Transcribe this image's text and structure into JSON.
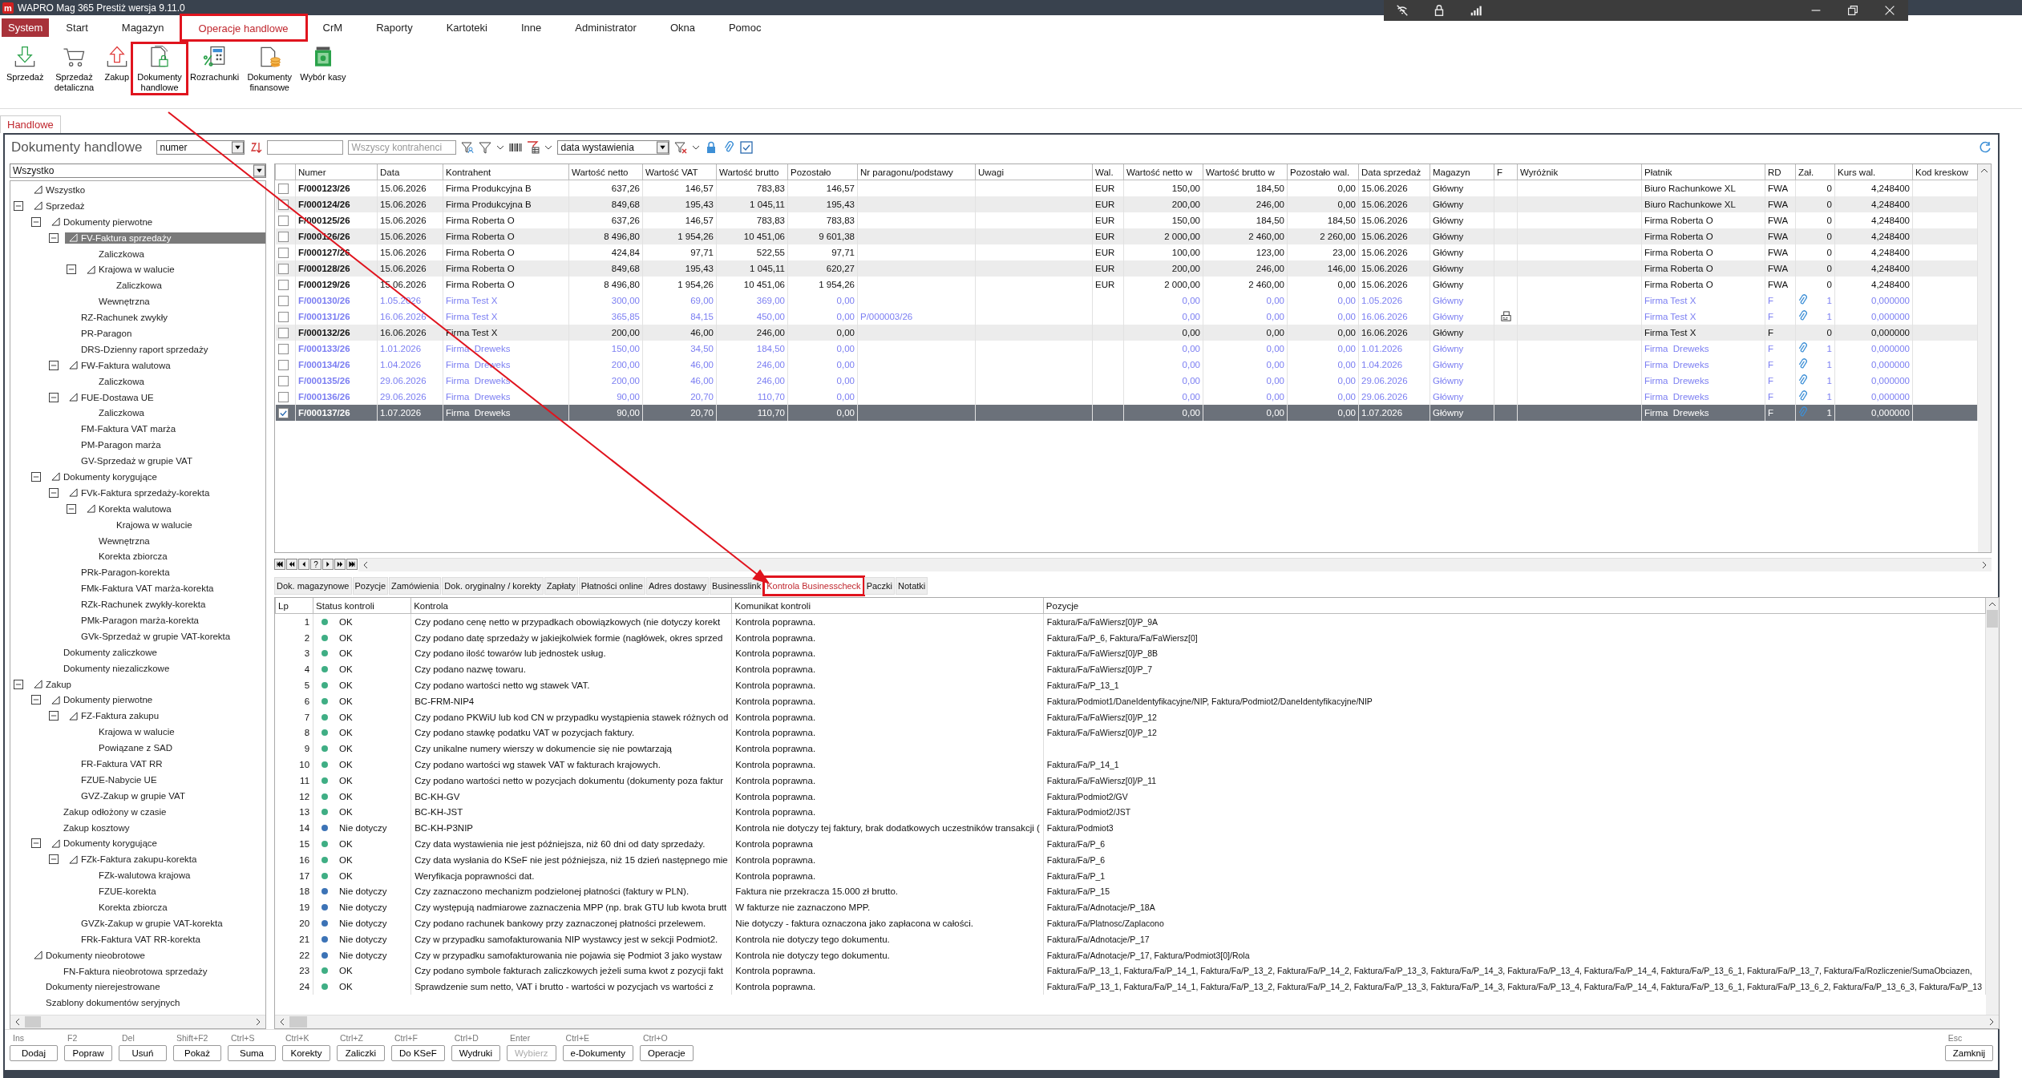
{
  "window": {
    "logo_letter": "m",
    "title": "WAPRO Mag 365 Prestiż  wersja 9.11.0"
  },
  "menu": [
    {
      "label": "System",
      "kind": "app",
      "selected": false,
      "highlighted": false
    },
    {
      "label": "Start",
      "kind": "menu",
      "selected": false,
      "highlighted": false
    },
    {
      "label": "Magazyn",
      "kind": "menu",
      "selected": false,
      "highlighted": false
    },
    {
      "label": "Operacje handlowe",
      "kind": "menu",
      "selected": true,
      "highlighted": true
    },
    {
      "label": "CrM",
      "kind": "menu",
      "selected": false,
      "highlighted": false
    },
    {
      "label": "Raporty",
      "kind": "menu",
      "selected": false,
      "highlighted": false
    },
    {
      "label": "Kartoteki",
      "kind": "menu",
      "selected": false,
      "highlighted": false
    },
    {
      "label": "Inne",
      "kind": "menu",
      "selected": false,
      "highlighted": false
    },
    {
      "label": "Administrator",
      "kind": "menu",
      "selected": false,
      "highlighted": false
    },
    {
      "label": "Okna",
      "kind": "menu",
      "selected": false,
      "highlighted": false
    },
    {
      "label": "Pomoc",
      "kind": "menu",
      "selected": false,
      "highlighted": false
    }
  ],
  "ribbon": [
    {
      "label": "Sprzedaż",
      "highlighted": false
    },
    {
      "label": "Sprzedaż detaliczna",
      "highlighted": false
    },
    {
      "label": "Zakup",
      "highlighted": false
    },
    {
      "label": "Dokumenty handlowe",
      "highlighted": true
    },
    {
      "label": "Rozrachunki",
      "highlighted": false
    },
    {
      "label": "Dokumenty finansowe",
      "highlighted": false
    },
    {
      "label": "Wybór kasy",
      "highlighted": false
    }
  ],
  "page_tabs": [
    {
      "label": "Handlowe",
      "selected": true
    }
  ],
  "filter_bar": {
    "title": "Dokumenty handlowe",
    "sort_field": "numer",
    "contractor_placeholder": "Wszyscy kontrahenci",
    "date_field": "data wystawienia"
  },
  "tree": {
    "filter": "Wszystko",
    "items": [
      {
        "label": "Wszystko",
        "kind": "folder",
        "selected": false
      },
      {
        "label": "Sprzedaż",
        "kind": "folder",
        "selected": false,
        "expanded": true,
        "children": [
          {
            "label": "Dokumenty pierwotne",
            "kind": "folder",
            "selected": false,
            "expanded": true,
            "children": [
              {
                "label": "FV-Faktura sprzedaży",
                "kind": "folder",
                "selected": true,
                "expanded": true,
                "children": [
                  {
                    "label": "Zaliczkowa",
                    "kind": "leaf",
                    "selected": false
                  },
                  {
                    "label": "Krajowa w walucie",
                    "kind": "folder",
                    "selected": false,
                    "expanded": true,
                    "children": [
                      {
                        "label": "Zaliczkowa",
                        "kind": "leaf",
                        "selected": false
                      }
                    ]
                  },
                  {
                    "label": "Wewnętrzna",
                    "kind": "leaf",
                    "selected": false
                  }
                ]
              },
              {
                "label": "RZ-Rachunek zwykły",
                "kind": "leaf",
                "selected": false
              },
              {
                "label": "PR-Paragon",
                "kind": "leaf",
                "selected": false
              },
              {
                "label": "DRS-Dzienny raport sprzedaży",
                "kind": "leaf",
                "selected": false
              },
              {
                "label": "FW-Faktura walutowa",
                "kind": "folder",
                "selected": false,
                "expanded": true,
                "children": [
                  {
                    "label": "Zaliczkowa",
                    "kind": "leaf",
                    "selected": false
                  }
                ]
              },
              {
                "label": "FUE-Dostawa UE",
                "kind": "folder",
                "selected": false,
                "expanded": true,
                "children": [
                  {
                    "label": "Zaliczkowa",
                    "kind": "leaf",
                    "selected": false
                  }
                ]
              },
              {
                "label": "FM-Faktura VAT marża",
                "kind": "leaf",
                "selected": false
              },
              {
                "label": "PM-Paragon marża",
                "kind": "leaf",
                "selected": false
              },
              {
                "label": "GV-Sprzedaż w grupie VAT",
                "kind": "leaf",
                "selected": false
              }
            ]
          },
          {
            "label": "Dokumenty korygujące",
            "kind": "folder",
            "selected": false,
            "expanded": true,
            "children": [
              {
                "label": "FVk-Faktura sprzedaży-korekta",
                "kind": "folder",
                "selected": false,
                "expanded": true,
                "children": [
                  {
                    "label": "Korekta walutowa",
                    "kind": "folder",
                    "selected": false,
                    "expanded": true,
                    "children": [
                      {
                        "label": "Krajowa w walucie",
                        "kind": "leaf",
                        "selected": false
                      }
                    ]
                  },
                  {
                    "label": "Wewnętrzna",
                    "kind": "leaf",
                    "selected": false
                  },
                  {
                    "label": "Korekta zbiorcza",
                    "kind": "leaf",
                    "selected": false
                  }
                ]
              },
              {
                "label": "PRk-Paragon-korekta",
                "kind": "leaf",
                "selected": false
              },
              {
                "label": "FMk-Faktura VAT marża-korekta",
                "kind": "leaf",
                "selected": false
              },
              {
                "label": "RZk-Rachunek zwykły-korekta",
                "kind": "leaf",
                "selected": false
              },
              {
                "label": "PMk-Paragon marża-korekta",
                "kind": "leaf",
                "selected": false
              },
              {
                "label": "GVk-Sprzedaż w grupie VAT-korekta",
                "kind": "leaf",
                "selected": false
              }
            ]
          },
          {
            "label": "Dokumenty zaliczkowe",
            "kind": "leaf",
            "selected": false
          },
          {
            "label": "Dokumenty niezaliczkowe",
            "kind": "leaf",
            "selected": false
          }
        ]
      },
      {
        "label": "Zakup",
        "kind": "folder",
        "selected": false,
        "expanded": true,
        "children": [
          {
            "label": "Dokumenty pierwotne",
            "kind": "folder",
            "selected": false,
            "expanded": true,
            "children": [
              {
                "label": "FZ-Faktura zakupu",
                "kind": "folder",
                "selected": false,
                "expanded": true,
                "children": [
                  {
                    "label": "Krajowa w walucie",
                    "kind": "leaf",
                    "selected": false
                  },
                  {
                    "label": "Powiązane z SAD",
                    "kind": "leaf",
                    "selected": false
                  }
                ]
              },
              {
                "label": "FR-Faktura VAT RR",
                "kind": "leaf",
                "selected": false
              },
              {
                "label": "FZUE-Nabycie UE",
                "kind": "leaf",
                "selected": false
              },
              {
                "label": "GVZ-Zakup w grupie VAT",
                "kind": "leaf",
                "selected": false
              }
            ]
          },
          {
            "label": "Zakup odłożony w czasie",
            "kind": "leaf",
            "selected": false
          },
          {
            "label": "Zakup kosztowy",
            "kind": "leaf",
            "selected": false
          },
          {
            "label": "Dokumenty korygujące",
            "kind": "folder",
            "selected": false,
            "expanded": true,
            "children": [
              {
                "label": "FZk-Faktura zakupu-korekta",
                "kind": "folder",
                "selected": false,
                "expanded": true,
                "children": [
                  {
                    "label": "FZk-walutowa krajowa",
                    "kind": "leaf",
                    "selected": false
                  },
                  {
                    "label": "FZUE-korekta",
                    "kind": "leaf",
                    "selected": false
                  },
                  {
                    "label": "Korekta zbiorcza",
                    "kind": "leaf",
                    "selected": false
                  }
                ]
              },
              {
                "label": "GVZk-Zakup w grupie VAT-korekta",
                "kind": "leaf",
                "selected": false
              },
              {
                "label": "FRk-Faktura VAT RR-korekta",
                "kind": "leaf",
                "selected": false
              }
            ]
          }
        ]
      },
      {
        "label": "Dokumenty nieobrotowe",
        "kind": "folder",
        "selected": false,
        "children": [
          {
            "label": "FN-Faktura nieobrotowa sprzedaży",
            "kind": "leaf",
            "selected": false
          }
        ]
      },
      {
        "label": "Dokumenty nierejestrowane",
        "kind": "leaf",
        "selected": false
      },
      {
        "label": "Szablony dokumentów seryjnych",
        "kind": "leaf",
        "selected": false
      }
    ]
  },
  "documents": {
    "columns": [
      {
        "label": "Numer",
        "kind": "text"
      },
      {
        "label": "Data",
        "kind": "text"
      },
      {
        "label": "Kontrahent",
        "kind": "text"
      },
      {
        "label": "Wartość netto",
        "kind": "num"
      },
      {
        "label": "Wartość VAT",
        "kind": "num"
      },
      {
        "label": "Wartość brutto",
        "kind": "num"
      },
      {
        "label": "Pozostało",
        "kind": "num"
      },
      {
        "label": "Nr paragonu/podstawy",
        "kind": "text"
      },
      {
        "label": "Uwagi",
        "kind": "text"
      },
      {
        "label": "Wal.",
        "kind": "text"
      },
      {
        "label": "Wartość netto w",
        "kind": "num"
      },
      {
        "label": "Wartość brutto w",
        "kind": "num"
      },
      {
        "label": "Pozostało wal.",
        "kind": "num"
      },
      {
        "label": "Data sprzedaż",
        "kind": "text"
      },
      {
        "label": "Magazyn",
        "kind": "text"
      },
      {
        "label": "F",
        "kind": "flag"
      },
      {
        "label": "Wyróżnik",
        "kind": "text"
      },
      {
        "label": "Płatnik",
        "kind": "text"
      },
      {
        "label": "RD",
        "kind": "text"
      },
      {
        "label": "Zał.",
        "kind": "attach"
      },
      {
        "label": "Kurs wal.",
        "kind": "num"
      },
      {
        "label": "Kod kreskow",
        "kind": "text"
      }
    ],
    "rows": [
      {
        "selected": false,
        "checked": false,
        "dimmed": false,
        "fiscal": false,
        "attachment": false,
        "cells": [
          "F/000123/26",
          "15.06.2026",
          "Firma Produkcyjna B",
          "637,26",
          "146,57",
          "783,83",
          "146,57",
          null,
          null,
          "EUR",
          "150,00",
          "184,50",
          "0,00",
          "15.06.2026",
          "Główny",
          null,
          null,
          "Biuro Rachunkowe XL",
          "FWA",
          "0",
          "4,248400",
          null
        ]
      },
      {
        "selected": false,
        "checked": false,
        "dimmed": false,
        "fiscal": false,
        "attachment": false,
        "cells": [
          "F/000124/26",
          "15.06.2026",
          "Firma Produkcyjna B",
          "849,68",
          "195,43",
          "1 045,11",
          "195,43",
          null,
          null,
          "EUR",
          "200,00",
          "246,00",
          "0,00",
          "15.06.2026",
          "Główny",
          null,
          null,
          "Biuro Rachunkowe XL",
          "FWA",
          "0",
          "4,248400",
          null
        ]
      },
      {
        "selected": false,
        "checked": false,
        "dimmed": false,
        "fiscal": false,
        "attachment": false,
        "cells": [
          "F/000125/26",
          "15.06.2026",
          "Firma Roberta O",
          "637,26",
          "146,57",
          "783,83",
          "783,83",
          null,
          null,
          "EUR",
          "150,00",
          "184,50",
          "184,50",
          "15.06.2026",
          "Główny",
          null,
          null,
          "Firma Roberta O",
          "FWA",
          "0",
          "4,248400",
          null
        ]
      },
      {
        "selected": false,
        "checked": false,
        "dimmed": false,
        "fiscal": false,
        "attachment": false,
        "cells": [
          "F/000126/26",
          "15.06.2026",
          "Firma Roberta O",
          "8 496,80",
          "1 954,26",
          "10 451,06",
          "9 601,38",
          null,
          null,
          "EUR",
          "2 000,00",
          "2 460,00",
          "2 260,00",
          "15.06.2026",
          "Główny",
          null,
          null,
          "Firma Roberta O",
          "FWA",
          "0",
          "4,248400",
          null
        ]
      },
      {
        "selected": false,
        "checked": false,
        "dimmed": false,
        "fiscal": false,
        "attachment": false,
        "cells": [
          "F/000127/26",
          "15.06.2026",
          "Firma Roberta O",
          "424,84",
          "97,71",
          "522,55",
          "97,71",
          null,
          null,
          "EUR",
          "100,00",
          "123,00",
          "23,00",
          "15.06.2026",
          "Główny",
          null,
          null,
          "Firma Roberta O",
          "FWA",
          "0",
          "4,248400",
          null
        ]
      },
      {
        "selected": false,
        "checked": false,
        "dimmed": false,
        "fiscal": false,
        "attachment": false,
        "cells": [
          "F/000128/26",
          "15.06.2026",
          "Firma Roberta O",
          "849,68",
          "195,43",
          "1 045,11",
          "620,27",
          null,
          null,
          "EUR",
          "200,00",
          "246,00",
          "146,00",
          "15.06.2026",
          "Główny",
          null,
          null,
          "Firma Roberta O",
          "FWA",
          "0",
          "4,248400",
          null
        ]
      },
      {
        "selected": false,
        "checked": false,
        "dimmed": false,
        "fiscal": false,
        "attachment": false,
        "cells": [
          "F/000129/26",
          "15.06.2026",
          "Firma Roberta O",
          "8 496,80",
          "1 954,26",
          "10 451,06",
          "1 954,26",
          null,
          null,
          "EUR",
          "2 000,00",
          "2 460,00",
          "0,00",
          "15.06.2026",
          "Główny",
          null,
          null,
          "Firma Roberta O",
          "FWA",
          "0",
          "4,248400",
          null
        ]
      },
      {
        "selected": false,
        "checked": false,
        "dimmed": true,
        "fiscal": false,
        "attachment": true,
        "cells": [
          "F/000130/26",
          "1.05.2026",
          "Firma Test X",
          "300,00",
          "69,00",
          "369,00",
          "0,00",
          null,
          null,
          null,
          "0,00",
          "0,00",
          "0,00",
          "1.05.2026",
          "Główny",
          null,
          null,
          "Firma Test X",
          "F",
          "1",
          "0,000000",
          null
        ]
      },
      {
        "selected": false,
        "checked": false,
        "dimmed": true,
        "fiscal": true,
        "attachment": true,
        "cells": [
          "F/000131/26",
          "16.06.2026",
          "Firma Test X",
          "365,85",
          "84,15",
          "450,00",
          "0,00",
          "P/000003/26",
          null,
          null,
          "0,00",
          "0,00",
          "0,00",
          "16.06.2026",
          "Główny",
          null,
          null,
          "Firma Test X",
          "F",
          "1",
          "0,000000",
          null
        ]
      },
      {
        "selected": false,
        "checked": false,
        "dimmed": false,
        "fiscal": false,
        "attachment": false,
        "cells": [
          "F/000132/26",
          "16.06.2026",
          "Firma Test X",
          "200,00",
          "46,00",
          "246,00",
          "0,00",
          null,
          null,
          null,
          "0,00",
          "0,00",
          "0,00",
          "16.06.2026",
          "Główny",
          null,
          null,
          "Firma Test X",
          "F",
          "0",
          "0,000000",
          null
        ]
      },
      {
        "selected": false,
        "checked": false,
        "dimmed": true,
        "fiscal": false,
        "attachment": true,
        "cells": [
          "F/000133/26",
          "1.01.2026",
          "Firma  Dreweks",
          "150,00",
          "34,50",
          "184,50",
          "0,00",
          null,
          null,
          null,
          "0,00",
          "0,00",
          "0,00",
          "1.01.2026",
          "Główny",
          null,
          null,
          "Firma  Dreweks",
          "F",
          "1",
          "0,000000",
          null
        ]
      },
      {
        "selected": false,
        "checked": false,
        "dimmed": true,
        "fiscal": false,
        "attachment": true,
        "cells": [
          "F/000134/26",
          "1.04.2026",
          "Firma  Dreweks",
          "200,00",
          "46,00",
          "246,00",
          "0,00",
          null,
          null,
          null,
          "0,00",
          "0,00",
          "0,00",
          "1.04.2026",
          "Główny",
          null,
          null,
          "Firma  Dreweks",
          "F",
          "1",
          "0,000000",
          null
        ]
      },
      {
        "selected": false,
        "checked": false,
        "dimmed": true,
        "fiscal": false,
        "attachment": true,
        "cells": [
          "F/000135/26",
          "29.06.2026",
          "Firma  Dreweks",
          "200,00",
          "46,00",
          "246,00",
          "0,00",
          null,
          null,
          null,
          "0,00",
          "0,00",
          "0,00",
          "29.06.2026",
          "Główny",
          null,
          null,
          "Firma  Dreweks",
          "F",
          "1",
          "0,000000",
          null
        ]
      },
      {
        "selected": false,
        "checked": false,
        "dimmed": true,
        "fiscal": false,
        "attachment": true,
        "cells": [
          "F/000136/26",
          "29.06.2026",
          "Firma  Dreweks",
          "90,00",
          "20,70",
          "110,70",
          "0,00",
          null,
          null,
          null,
          "0,00",
          "0,00",
          "0,00",
          "29.06.2026",
          "Główny",
          null,
          null,
          "Firma  Dreweks",
          "F",
          "1",
          "0,000000",
          null
        ]
      },
      {
        "selected": true,
        "checked": true,
        "dimmed": true,
        "fiscal": false,
        "attachment": true,
        "cells": [
          "F/000137/26",
          "1.07.2026",
          "Firma  Dreweks",
          "90,00",
          "20,70",
          "110,70",
          "0,00",
          null,
          null,
          null,
          "0,00",
          "0,00",
          "0,00",
          "1.07.2026",
          "Główny",
          null,
          null,
          "Firma  Dreweks",
          "F",
          "1",
          "0,000000",
          null
        ]
      }
    ]
  },
  "record_nav": {
    "help": "?"
  },
  "detail_tabs": [
    {
      "label": "Dok. magazynowe",
      "selected": false,
      "highlighted": false
    },
    {
      "label": "Pozycje",
      "selected": false,
      "highlighted": false
    },
    {
      "label": "Zamówienia",
      "selected": false,
      "highlighted": false
    },
    {
      "label": "Dok. oryginalny / korekty",
      "selected": false,
      "highlighted": false
    },
    {
      "label": "Zapłaty",
      "selected": false,
      "highlighted": false
    },
    {
      "label": "Płatności online",
      "selected": false,
      "highlighted": false
    },
    {
      "label": "Adres dostawy",
      "selected": false,
      "highlighted": false
    },
    {
      "label": "Businesslink",
      "selected": false,
      "highlighted": false
    },
    {
      "label": "Kontrola Businesscheck",
      "selected": true,
      "highlighted": true
    },
    {
      "label": "Paczki",
      "selected": false,
      "highlighted": false
    },
    {
      "label": "Notatki",
      "selected": false,
      "highlighted": false
    }
  ],
  "checks": {
    "columns": [
      "Lp",
      "Status kontroli",
      "Kontrola",
      "Komunikat kontroli",
      "Pozycje"
    ],
    "rows": [
      {
        "lp": "1",
        "status": "OK",
        "color": "#3fae84",
        "check": "Czy podano cenę netto w przypadkach obowiązkowych (nie dotyczy korekt",
        "message": "Kontrola poprawna.",
        "fields": "Faktura/Fa/FaWiersz[0]/P_9A"
      },
      {
        "lp": "2",
        "status": "OK",
        "color": "#3fae84",
        "check": "Czy podano datę sprzedaży w jakiejkolwiek formie (nagłówek, okres sprzed",
        "message": "Kontrola poprawna.",
        "fields": "Faktura/Fa/P_6, Faktura/Fa/FaWiersz[0]"
      },
      {
        "lp": "3",
        "status": "OK",
        "color": "#3fae84",
        "check": "Czy podano ilość towarów lub jednostek usług.",
        "message": "Kontrola poprawna.",
        "fields": "Faktura/Fa/FaWiersz[0]/P_8B"
      },
      {
        "lp": "4",
        "status": "OK",
        "color": "#3fae84",
        "check": "Czy podano nazwę towaru.",
        "message": "Kontrola poprawna.",
        "fields": "Faktura/Fa/FaWiersz[0]/P_7"
      },
      {
        "lp": "5",
        "status": "OK",
        "color": "#3fae84",
        "check": "Czy podano wartości netto wg stawek VAT.",
        "message": "Kontrola poprawna.",
        "fields": "Faktura/Fa/P_13_1"
      },
      {
        "lp": "6",
        "status": "OK",
        "color": "#3fae84",
        "check": "BC-FRM-NIP4",
        "message": "Kontrola poprawna.",
        "fields": "Faktura/Podmiot1/DaneIdentyfikacyjne/NIP, Faktura/Podmiot2/DaneIdentyfikacyjne/NIP"
      },
      {
        "lp": "7",
        "status": "OK",
        "color": "#3fae84",
        "check": "Czy podano PKWiU lub kod CN w przypadku wystąpienia stawek różnych od",
        "message": "Kontrola poprawna.",
        "fields": "Faktura/Fa/FaWiersz[0]/P_12"
      },
      {
        "lp": "8",
        "status": "OK",
        "color": "#3fae84",
        "check": "Czy podano stawkę podatku VAT w pozycjach faktury.",
        "message": "Kontrola poprawna.",
        "fields": "Faktura/Fa/FaWiersz[0]/P_12"
      },
      {
        "lp": "9",
        "status": "OK",
        "color": "#3fae84",
        "check": "Czy unikalne numery wierszy w dokumencie się nie powtarzają",
        "message": "Kontrola poprawna."
      },
      {
        "lp": "10",
        "status": "OK",
        "color": "#3fae84",
        "check": "Czy podano wartości wg stawek VAT w fakturach krajowych.",
        "message": "Kontrola poprawna.",
        "fields": "Faktura/Fa/P_14_1"
      },
      {
        "lp": "11",
        "status": "OK",
        "color": "#3fae84",
        "check": "Czy podano wartości netto w pozycjach dokumentu (dokumenty poza faktur",
        "message": "Kontrola poprawna.",
        "fields": "Faktura/Fa/FaWiersz[0]/P_11"
      },
      {
        "lp": "12",
        "status": "OK",
        "color": "#3fae84",
        "check": "BC-KH-GV",
        "message": "Kontrola poprawna.",
        "fields": "Faktura/Podmiot2/GV"
      },
      {
        "lp": "13",
        "status": "OK",
        "color": "#3fae84",
        "check": "BC-KH-JST",
        "message": "Kontrola poprawna.",
        "fields": "Faktura/Podmiot2/JST"
      },
      {
        "lp": "14",
        "status": "Nie dotyczy",
        "color": "#3c73b6",
        "check": "BC-KH-P3NIP",
        "message": "Kontrola nie dotyczy tej faktury, brak dodatkowych uczestników transakcji (",
        "fields": "Faktura/Podmiot3"
      },
      {
        "lp": "15",
        "status": "OK",
        "color": "#3fae84",
        "check": "Czy data wystawienia nie jest późniejsza, niż 60 dni od daty sprzedaży.",
        "message": "Kontrola poprawna",
        "fields": "Faktura/Fa/P_6"
      },
      {
        "lp": "16",
        "status": "OK",
        "color": "#3fae84",
        "check": "Czy data wysłania do KSeF nie jest późniejsza, niż 15 dzień następnego mie",
        "message": "Kontrola poprawna.",
        "fields": "Faktura/Fa/P_6"
      },
      {
        "lp": "17",
        "status": "OK",
        "color": "#3fae84",
        "check": "Weryfikacja poprawności dat.",
        "message": "Kontrola poprawna.",
        "fields": "Faktura/Fa/P_1"
      },
      {
        "lp": "18",
        "status": "Nie dotyczy",
        "color": "#3c73b6",
        "check": "Czy zaznaczono mechanizm podzielonej płatności (faktury w PLN).",
        "message": "Faktura nie przekracza 15.000 zł brutto.",
        "fields": "Faktura/Fa/P_15"
      },
      {
        "lp": "19",
        "status": "Nie dotyczy",
        "color": "#3c73b6",
        "check": "Czy występują nadmiarowe zaznaczenia MPP (np. brak GTU lub kwota brutt",
        "message": "W fakturze nie zaznaczono MPP.",
        "fields": "Faktura/Fa/Adnotacje/P_18A"
      },
      {
        "lp": "20",
        "status": "Nie dotyczy",
        "color": "#3c73b6",
        "check": "Czy podano rachunek bankowy przy zaznaczonej płatności przelewem.",
        "message": "Nie dotyczy - faktura oznaczona jako zapłacona w całości.",
        "fields": "Faktura/Fa/Platnosc/Zaplacono"
      },
      {
        "lp": "21",
        "status": "Nie dotyczy",
        "color": "#3c73b6",
        "check": "Czy w przypadku samofakturowania NIP wystawcy jest w sekcji Podmiot2.",
        "message": "Kontrola nie dotyczy tego dokumentu.",
        "fields": "Faktura/Fa/Adnotacje/P_17"
      },
      {
        "lp": "22",
        "status": "Nie dotyczy",
        "color": "#3c73b6",
        "check": "Czy w przypadku samofakturowania nie pojawia się Podmiot 3 jako wystaw",
        "message": "Kontrola nie dotyczy tego dokumentu.",
        "fields": "Faktura/Fa/Adnotacje/P_17, Faktura/Podmiot3[0]/Rola"
      },
      {
        "lp": "23",
        "status": "OK",
        "color": "#3fae84",
        "check": "Czy podano symbole fakturach zaliczkowych jeżeli suma kwot z pozycji fakt",
        "message": "Kontrola poprawna.",
        "fields": "Faktura/Fa/P_13_1, Faktura/Fa/P_14_1, Faktura/Fa/P_13_2, Faktura/Fa/P_14_2, Faktura/Fa/P_13_3, Faktura/Fa/P_14_3, Faktura/Fa/P_13_4, Faktura/Fa/P_14_4, Faktura/Fa/P_13_6_1, Faktura/Fa/P_13_7, Faktura/Fa/Rozliczenie/SumaObciazen,"
      },
      {
        "lp": "24",
        "status": "OK",
        "color": "#3fae84",
        "check": "Sprawdzenie sum netto, VAT i brutto - wartości w pozycjach vs wartości z",
        "message": "Kontrola poprawna.",
        "fields": "Faktura/Fa/P_13_1, Faktura/Fa/P_14_1, Faktura/Fa/P_13_2, Faktura/Fa/P_14_2, Faktura/Fa/P_13_3, Faktura/Fa/P_14_3, Faktura/Fa/P_13_4, Faktura/Fa/P_14_4, Faktura/Fa/P_13_6_1, Faktura/Fa/P_13_6_2, Faktura/Fa/P_13_6_3, Faktura/Fa/P_13"
      }
    ]
  },
  "function_keys": [
    {
      "key": "Ins",
      "label": "Dodaj",
      "disabled": false
    },
    {
      "key": "F2",
      "label": "Popraw",
      "disabled": false
    },
    {
      "key": "Del",
      "label": "Usuń",
      "disabled": false
    },
    {
      "key": "Shift+F2",
      "label": "Pokaż",
      "disabled": false
    },
    {
      "key": "Ctrl+S",
      "label": "Suma",
      "disabled": false
    },
    {
      "key": "Ctrl+K",
      "label": "Korekty",
      "disabled": false
    },
    {
      "key": "Ctrl+Z",
      "label": "Zaliczki",
      "disabled": false
    },
    {
      "key": "Ctrl+F",
      "label": "Do KSeF",
      "disabled": false
    },
    {
      "key": "Ctrl+D",
      "label": "Wydruki",
      "disabled": false
    },
    {
      "key": "Enter",
      "label": "Wybierz",
      "disabled": true
    },
    {
      "key": "Ctrl+E",
      "label": "e-Dokumenty",
      "disabled": false
    },
    {
      "key": "Ctrl+O",
      "label": "Operacje",
      "disabled": false
    }
  ],
  "close_key": {
    "key": "Esc",
    "label": "Zamknij"
  },
  "annotation_arrow": true
}
